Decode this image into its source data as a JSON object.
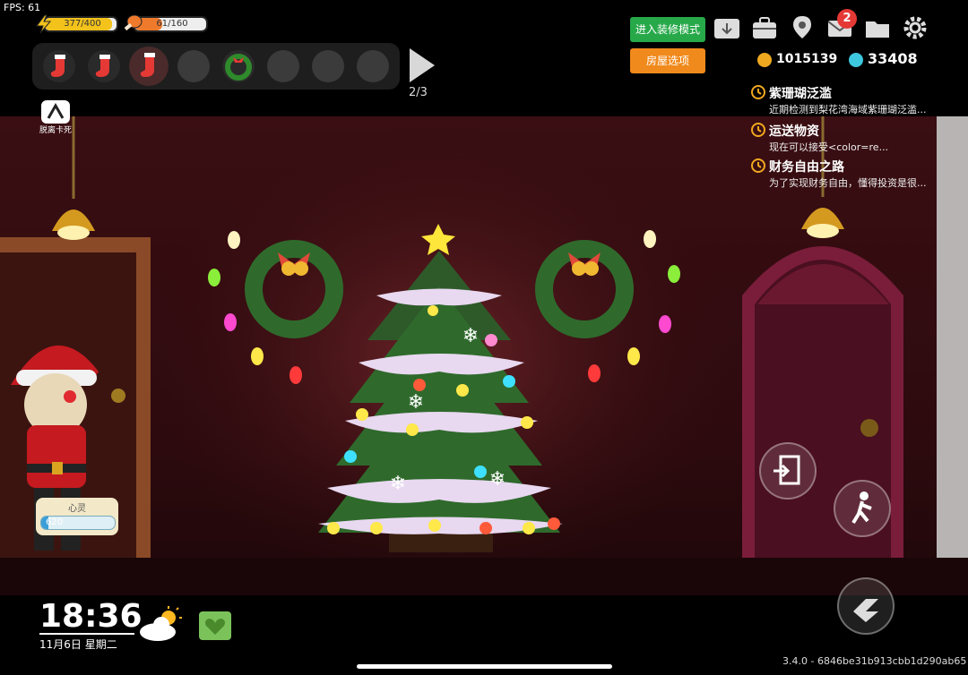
{
  "fps": "FPS: 61",
  "stats": {
    "energy": {
      "text": "377/400",
      "value": 377,
      "max": 400,
      "color": "#f3c21b"
    },
    "hunger": {
      "text": "61/160",
      "value": 61,
      "max": 160,
      "color": "#f07a2c"
    }
  },
  "hotbar": {
    "page": "2/3",
    "slots": [
      "stocking-icon",
      "stocking-icon",
      "stocking-icon",
      "empty",
      "wreath-icon",
      "empty",
      "empty",
      "empty"
    ]
  },
  "left_icon_label": "脱离卡死",
  "buttons": {
    "decorate_mode": "进入装修模式",
    "house_options": "房屋选项"
  },
  "top_icons": [
    "download-box-icon",
    "briefcase-icon",
    "map-pin-icon",
    "mail-icon",
    "folder-icon",
    "gear-icon"
  ],
  "mail_badge": "2",
  "currency": {
    "coins": "1015139",
    "gems": "33408"
  },
  "quests": [
    {
      "title": "紫珊瑚泛滥",
      "desc": "近期检测到梨花湾海域紫珊瑚泛滥..."
    },
    {
      "title": "运送物资",
      "desc": "现在可以接受<color=re..."
    },
    {
      "title": "财务自由之路",
      "desc": "为了实现财务自由，懂得投资是很..."
    }
  ],
  "mood": {
    "label": "心灵",
    "value": "620",
    "fill": 0.1
  },
  "clock": {
    "time": "18:36",
    "date": "11月6日 星期二"
  },
  "weather_icon": "partly-sunny-icon",
  "version": "3.4.0 - 6846be31b913cbb1d290ab65",
  "colors": {
    "green_button": "#27a94a",
    "orange_button": "#f08a1c",
    "badge": "#e53935"
  }
}
